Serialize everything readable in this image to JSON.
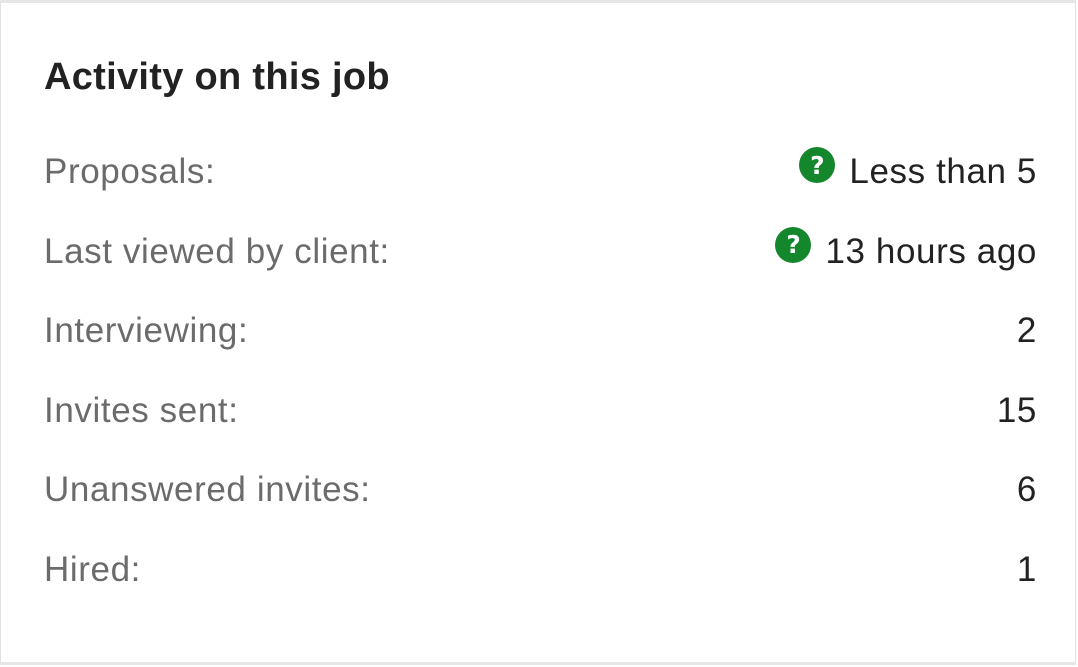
{
  "card": {
    "title": "Activity on this job",
    "help_icon_color": "#14862c",
    "rows": [
      {
        "label": "Proposals:",
        "value": "Less than 5",
        "has_help_icon": true
      },
      {
        "label": "Last viewed by client:",
        "value": "13 hours ago",
        "has_help_icon": true
      },
      {
        "label": "Interviewing:",
        "value": "2",
        "has_help_icon": false
      },
      {
        "label": "Invites sent:",
        "value": "15",
        "has_help_icon": false
      },
      {
        "label": "Unanswered invites:",
        "value": "6",
        "has_help_icon": false
      },
      {
        "label": "Hired:",
        "value": "1",
        "has_help_icon": false
      }
    ],
    "icons": {
      "help": "question-circle-icon"
    },
    "help_glyph": "?"
  }
}
